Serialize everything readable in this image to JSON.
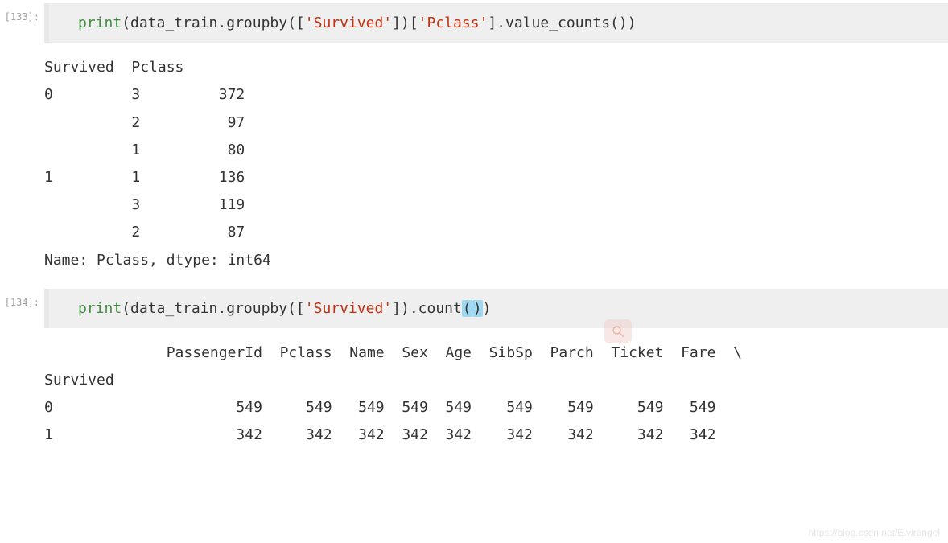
{
  "cells": {
    "c133": {
      "prompt": "[133]:",
      "code": {
        "func": "print",
        "mid1": "(data_train.groupby([",
        "str1": "'Survived'",
        "mid2": "])[",
        "str2": "'Pclass'",
        "mid3": "].value_counts())"
      },
      "output": "Survived  Pclass\n0         3         372\n          2          97\n          1          80\n1         1         136\n          3         119\n          2          87\nName: Pclass, dtype: int64"
    },
    "c134": {
      "prompt": "[134]:",
      "code": {
        "func": "print",
        "mid1": "(data_train.groupby([",
        "str1": "'Survived'",
        "mid2": "]).count",
        "lp": "(",
        "rp": ")",
        "end": ")"
      },
      "output": "              PassengerId  Pclass  Name  Sex  Age  SibSp  Parch  Ticket  Fare  \\\nSurvived                                                                        \n0                     549     549   549  549  549    549    549     549   549   \n1                     342     342   342  342  342    342    342     342   342   "
    }
  },
  "watermark": "https://blog.csdn.net/Elvirangel"
}
